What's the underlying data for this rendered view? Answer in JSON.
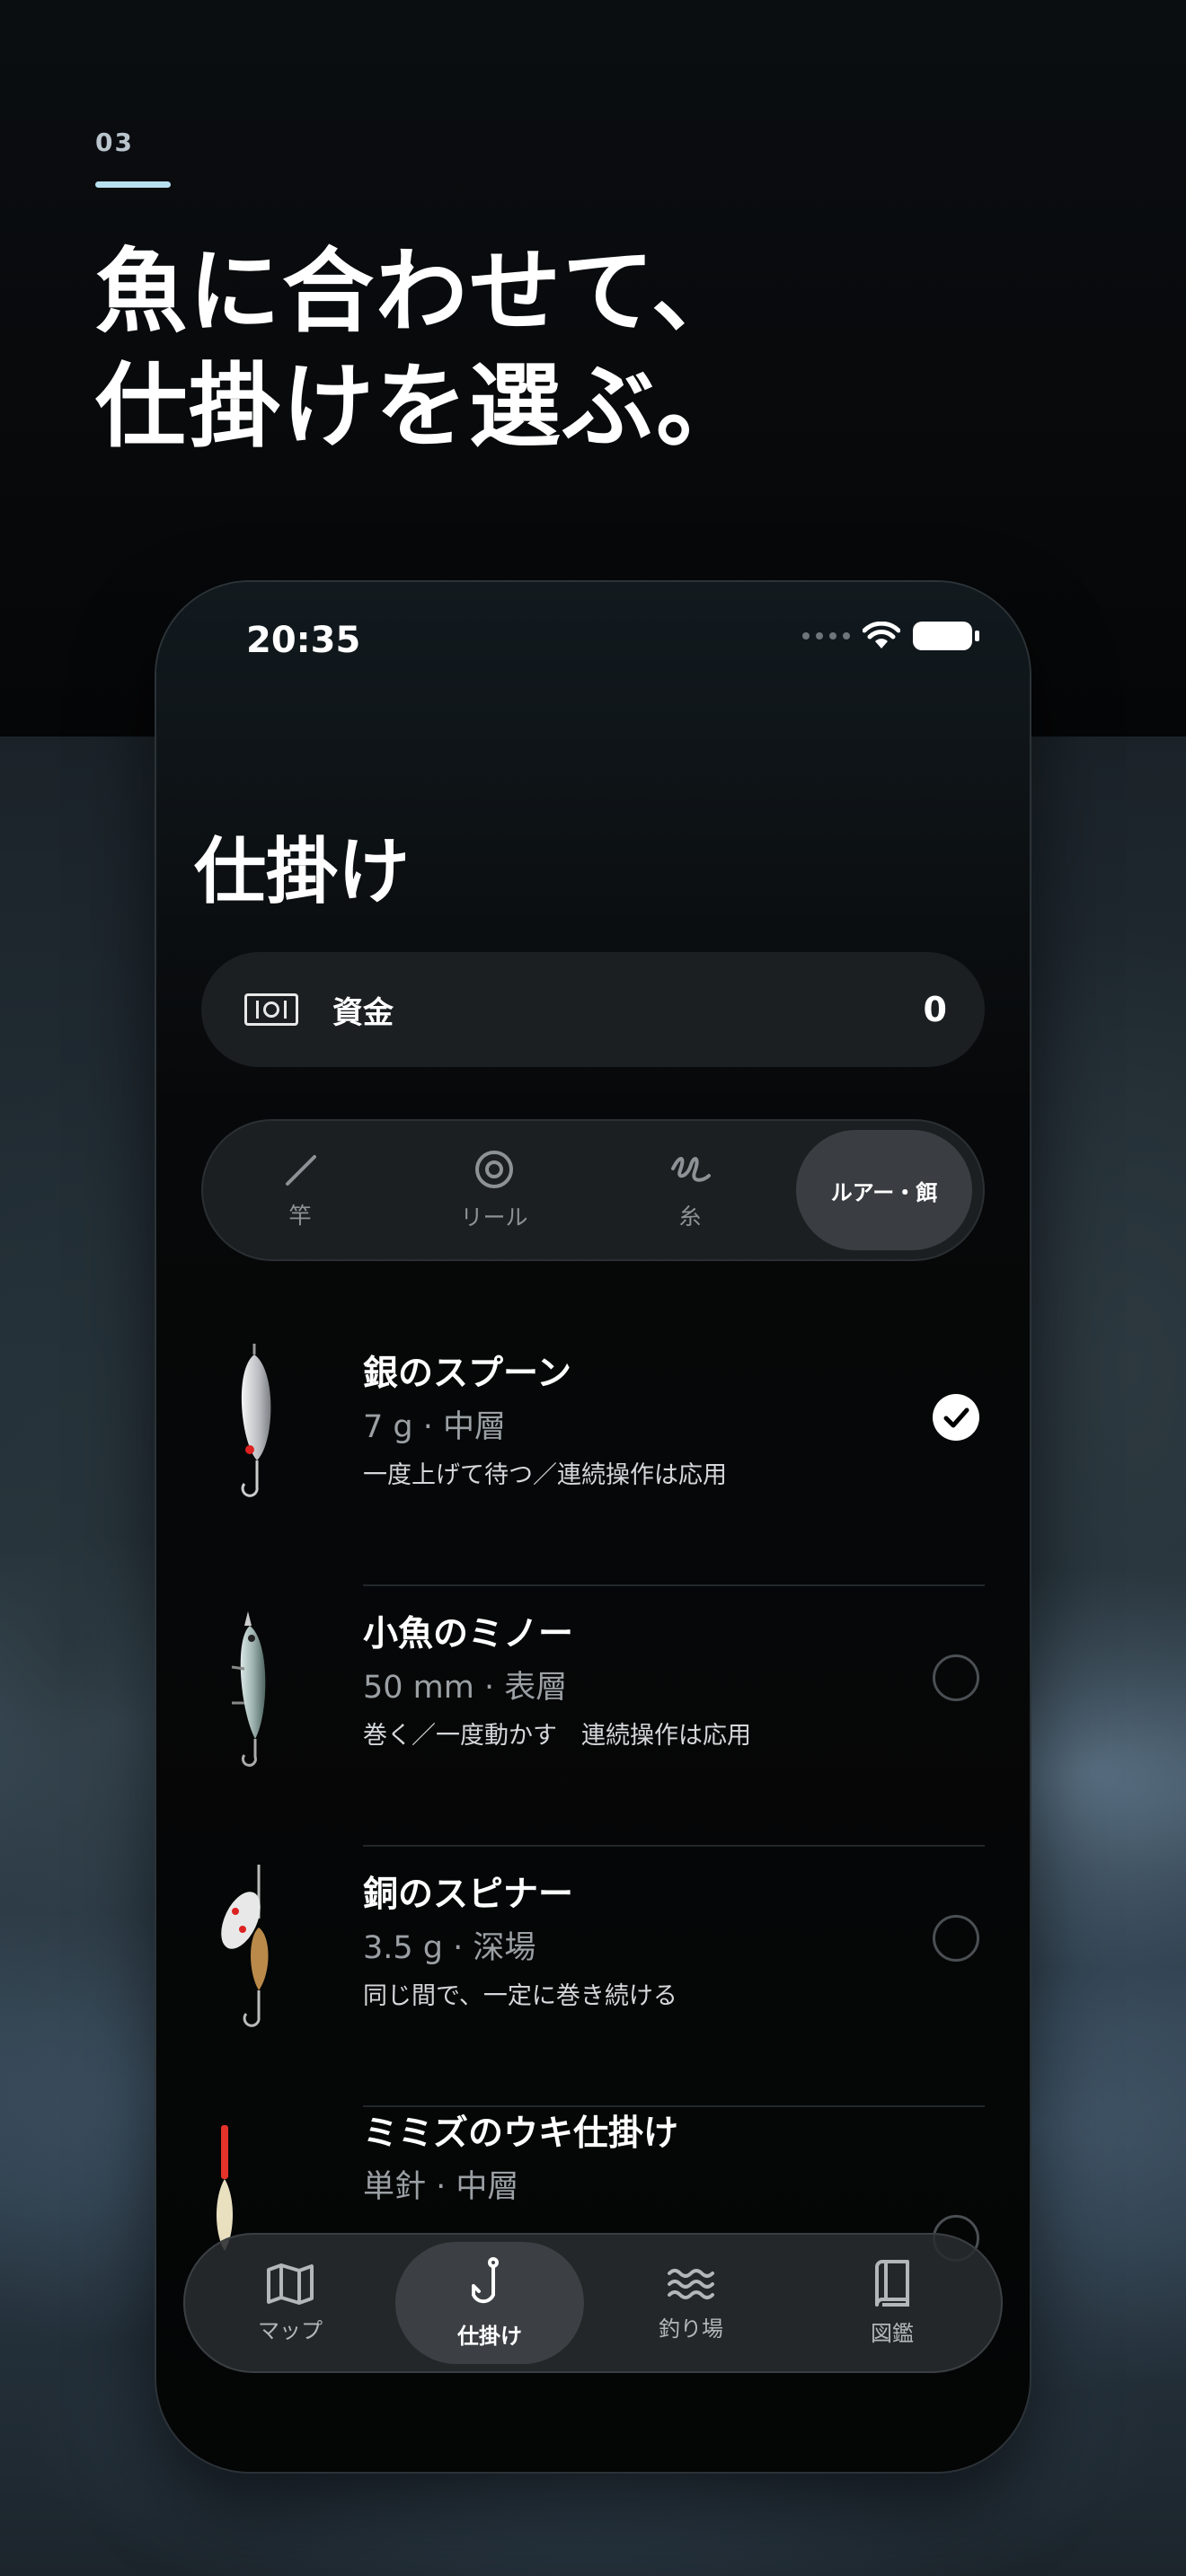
{
  "promo": {
    "step": "03",
    "headline_line1": "魚に合わせて、",
    "headline_line2": "仕掛けを選ぶ。"
  },
  "status_bar": {
    "time": "20:35"
  },
  "page_title": "仕掛け",
  "funds": {
    "label": "資金",
    "value": "0",
    "icon": "money-icon"
  },
  "tabs": [
    {
      "label": "竿",
      "icon": "rod-icon",
      "active": false
    },
    {
      "label": "リール",
      "icon": "reel-icon",
      "active": false
    },
    {
      "label": "糸",
      "icon": "line-icon",
      "active": false
    },
    {
      "label": "ルアー・餌",
      "active": true
    }
  ],
  "items": [
    {
      "name": "銀のスプーン",
      "spec": "7 g · 中層",
      "desc": "一度上げて待つ／連続操作は応用",
      "selected": true,
      "icon": "spoon-lure-icon"
    },
    {
      "name": "小魚のミノー",
      "spec": "50 mm · 表層",
      "desc": "巻く／一度動かす　連続操作は応用",
      "selected": false,
      "icon": "minnow-lure-icon"
    },
    {
      "name": "銅のスピナー",
      "spec": "3.5 g · 深場",
      "desc": "同じ間で、一定に巻き続ける",
      "selected": false,
      "icon": "spinner-lure-icon"
    },
    {
      "name": "ミミズのウキ仕掛け",
      "spec": "単針 · 中層",
      "desc": "",
      "selected": false,
      "icon": "float-rig-icon"
    }
  ],
  "bottom_nav": [
    {
      "label": "マップ",
      "icon": "map-icon",
      "active": false
    },
    {
      "label": "仕掛け",
      "icon": "hook-icon",
      "active": true
    },
    {
      "label": "釣り場",
      "icon": "waves-icon",
      "active": false
    },
    {
      "label": "図鑑",
      "icon": "book-icon",
      "active": false
    }
  ],
  "colors": {
    "accent_line": "#b8e1ef",
    "card_bg": "#1b1f22",
    "muted_text": "#9aa0a4"
  }
}
